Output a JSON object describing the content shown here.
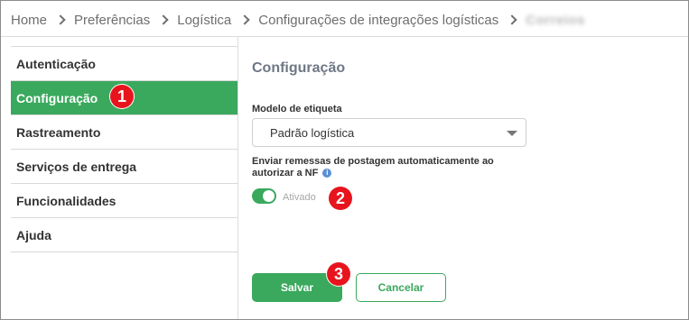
{
  "breadcrumb": {
    "items": [
      "Home",
      "Preferências",
      "Logística",
      "Configurações de integrações logísticas"
    ],
    "current": "Correios"
  },
  "sidebar": {
    "items": [
      {
        "label": "Autenticação"
      },
      {
        "label": "Configuração"
      },
      {
        "label": "Rastreamento"
      },
      {
        "label": "Serviços de entrega"
      },
      {
        "label": "Funcionalidades"
      },
      {
        "label": "Ajuda"
      }
    ],
    "active_index": 1
  },
  "content": {
    "title": "Configuração",
    "label_model": "Modelo de etiqueta",
    "select_value": "Padrão logística",
    "label_auto_send": "Enviar remessas de postagem automaticamente ao autorizar a NF",
    "info_glyph": "i",
    "toggle_state": "on",
    "toggle_label": "Ativado"
  },
  "buttons": {
    "save": "Salvar",
    "cancel": "Cancelar"
  },
  "markers": [
    "1",
    "2",
    "3"
  ],
  "colors": {
    "accent": "#3aa95d",
    "marker": "#e8141d",
    "info": "#5b8fd6"
  }
}
